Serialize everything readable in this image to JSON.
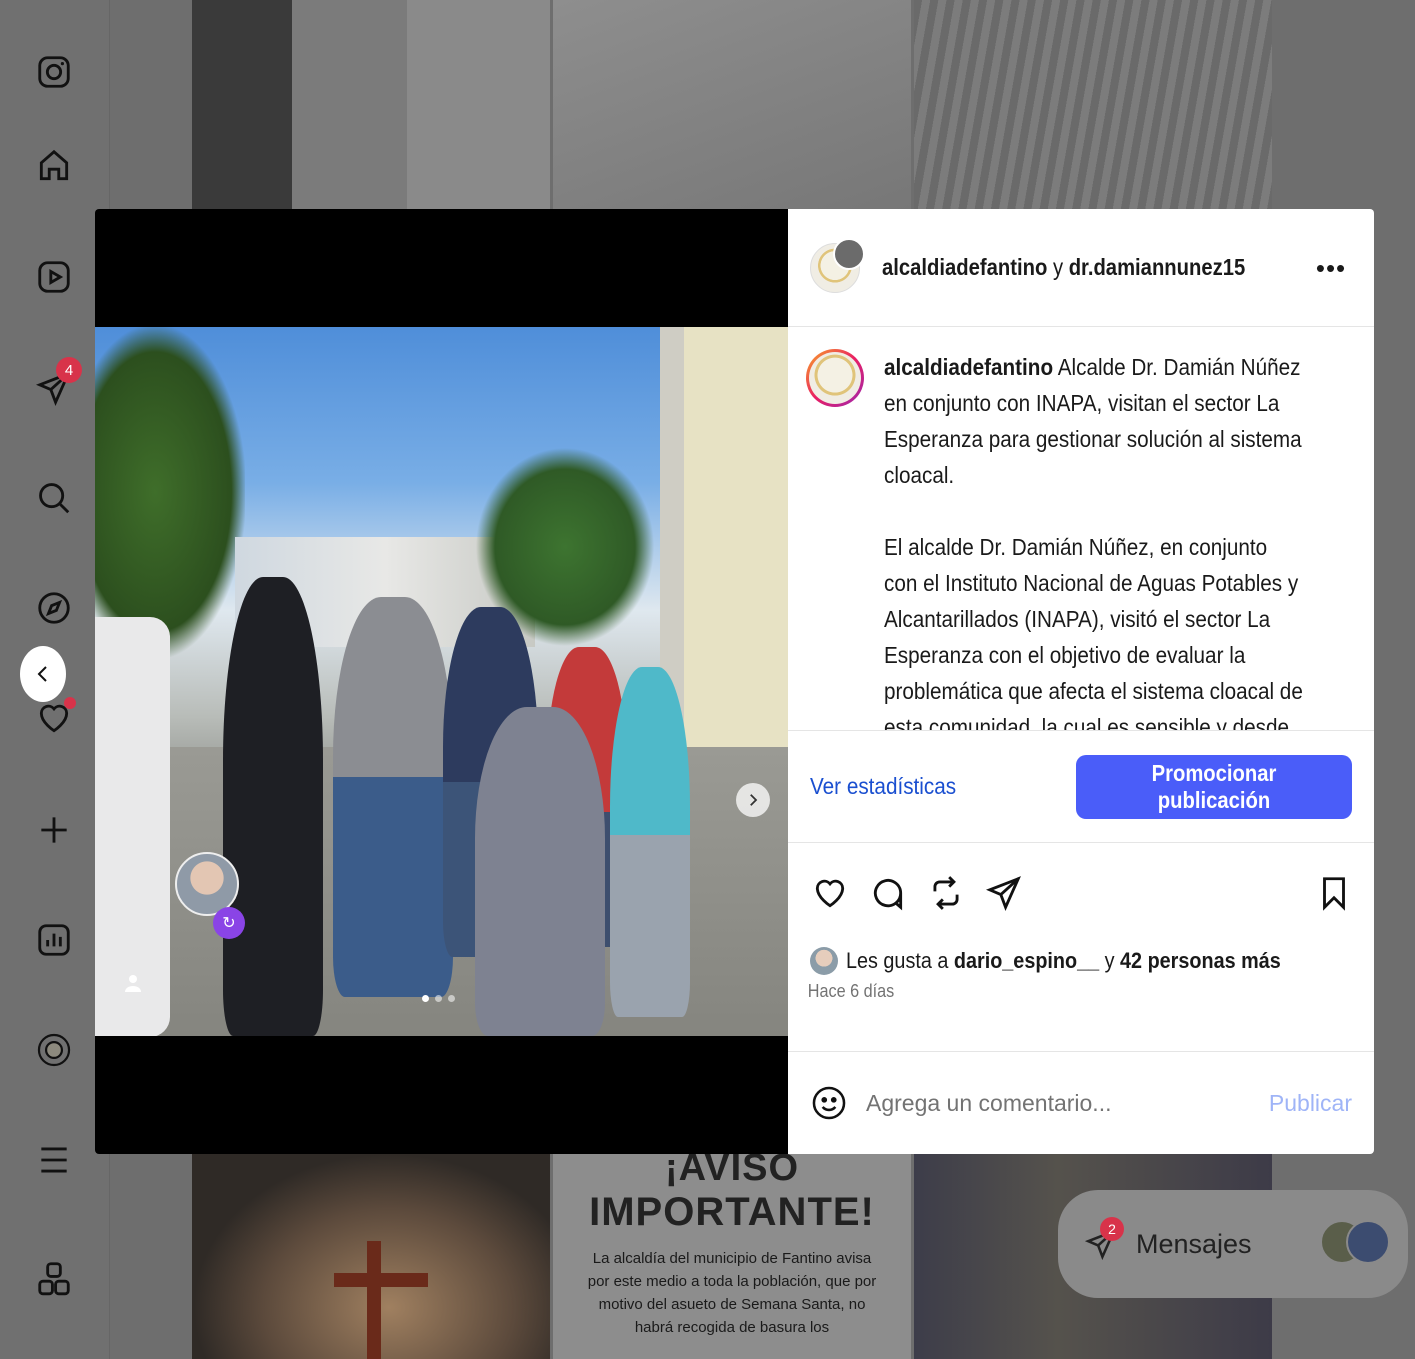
{
  "sidebar": {
    "notification_count": "4",
    "icons": [
      "instagram-icon",
      "home-icon",
      "reels-icon",
      "messages-icon",
      "search-icon",
      "explore-icon",
      "notifications-icon",
      "create-icon",
      "insights-icon",
      "profile-icon",
      "menu-icon",
      "more-icon"
    ]
  },
  "background": {
    "aviso_title_1": "¡AVISO",
    "aviso_title_2": "IMPORTANTE!",
    "aviso_body": "La alcaldía del municipio de Fantino avisa por este medio a toda la población, que por motivo del asueto de Semana Santa, no habrá recogida de basura los"
  },
  "messages": {
    "label": "Mensajes",
    "badge": "2"
  },
  "post": {
    "header": {
      "author": "alcaldiadefantino",
      "connector": " y ",
      "collaborator": "dr.damiannunez15",
      "more": "•••"
    },
    "caption": {
      "author": "alcaldiadefantino",
      "paragraph_1": " Alcalde Dr. Damián Núñez en conjunto con INAPA, visitan el sector La Esperanza para gestionar solución al sistema cloacal.",
      "paragraph_2": "El alcalde Dr. Damián Núñez, en conjunto con el Instituto Nacional de Aguas Potables y Alcantarillados (INAPA), visitó el sector La Esperanza con el objetivo de evaluar la problemática que afecta el sistema cloacal de esta comunidad, la cual es sensible y desde"
    },
    "stats_link": "Ver estadísticas",
    "promote_button": "Promocionar publicación",
    "likes": {
      "prefix": "Les gusta a ",
      "user": "dario_espino__",
      "middle": " y ",
      "others": "42 personas más"
    },
    "timestamp": "Hace 6 días",
    "comment": {
      "placeholder": "Agrega un comentario...",
      "post_label": "Publicar"
    },
    "carousel": {
      "slides": 3,
      "current": 1
    }
  },
  "colors": {
    "accent": "#4a5df9",
    "link": "#1a4fd0",
    "badge": "#d8334a",
    "post_disabled": "#9fb4f7"
  }
}
